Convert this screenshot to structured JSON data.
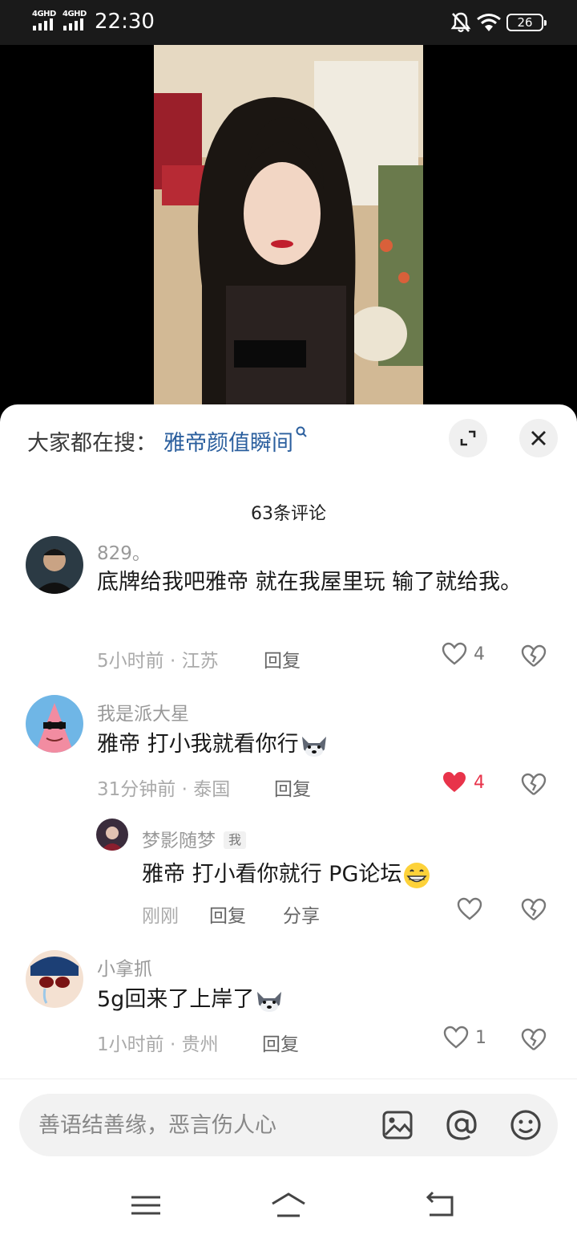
{
  "status_bar": {
    "network_1": "4GHD",
    "network_2": "4GHD",
    "time": "22:30",
    "battery": "26"
  },
  "search_hint": {
    "prefix": "大家都在搜：",
    "query": "雅帝颜值瞬间"
  },
  "comment_count": "63条评论",
  "comments": [
    {
      "username": "829。",
      "text": "底牌给我吧雅帝 就在我屋里玩 输了就给我。",
      "meta": "5小时前 · 江苏",
      "reply_label": "回复",
      "likes": "4",
      "liked": false
    },
    {
      "username": "我是派大星",
      "text": "雅帝 打小我就看你行",
      "meta": "31分钟前 · 泰国",
      "reply_label": "回复",
      "likes": "4",
      "liked": true
    },
    {
      "username": "梦影随梦",
      "badge": "我",
      "text": "雅帝  打小看你就行  PG论坛",
      "meta": "刚刚",
      "reply_label": "回复",
      "share_label": "分享",
      "likes": "",
      "liked": false
    },
    {
      "username": "小拿抓",
      "text": "5g回来了上岸了",
      "meta": "1小时前 · 贵州",
      "reply_label": "回复",
      "likes": "1",
      "liked": false
    }
  ],
  "input": {
    "placeholder": "善语结善缘，恶言伤人心"
  },
  "icons": {
    "bell_muted": "bell-slash-icon",
    "wifi": "wifi-icon",
    "expand": "expand-icon",
    "close": "close-icon",
    "heart": "heart-icon",
    "dislike": "broken-heart-icon",
    "image": "image-icon",
    "mention": "at-icon",
    "emoji": "smiley-icon",
    "nav_menu": "menu-icon",
    "nav_home": "home-icon",
    "nav_back": "back-icon"
  },
  "colors": {
    "link_blue": "#2b5f9e",
    "like_red": "#e8334a"
  }
}
